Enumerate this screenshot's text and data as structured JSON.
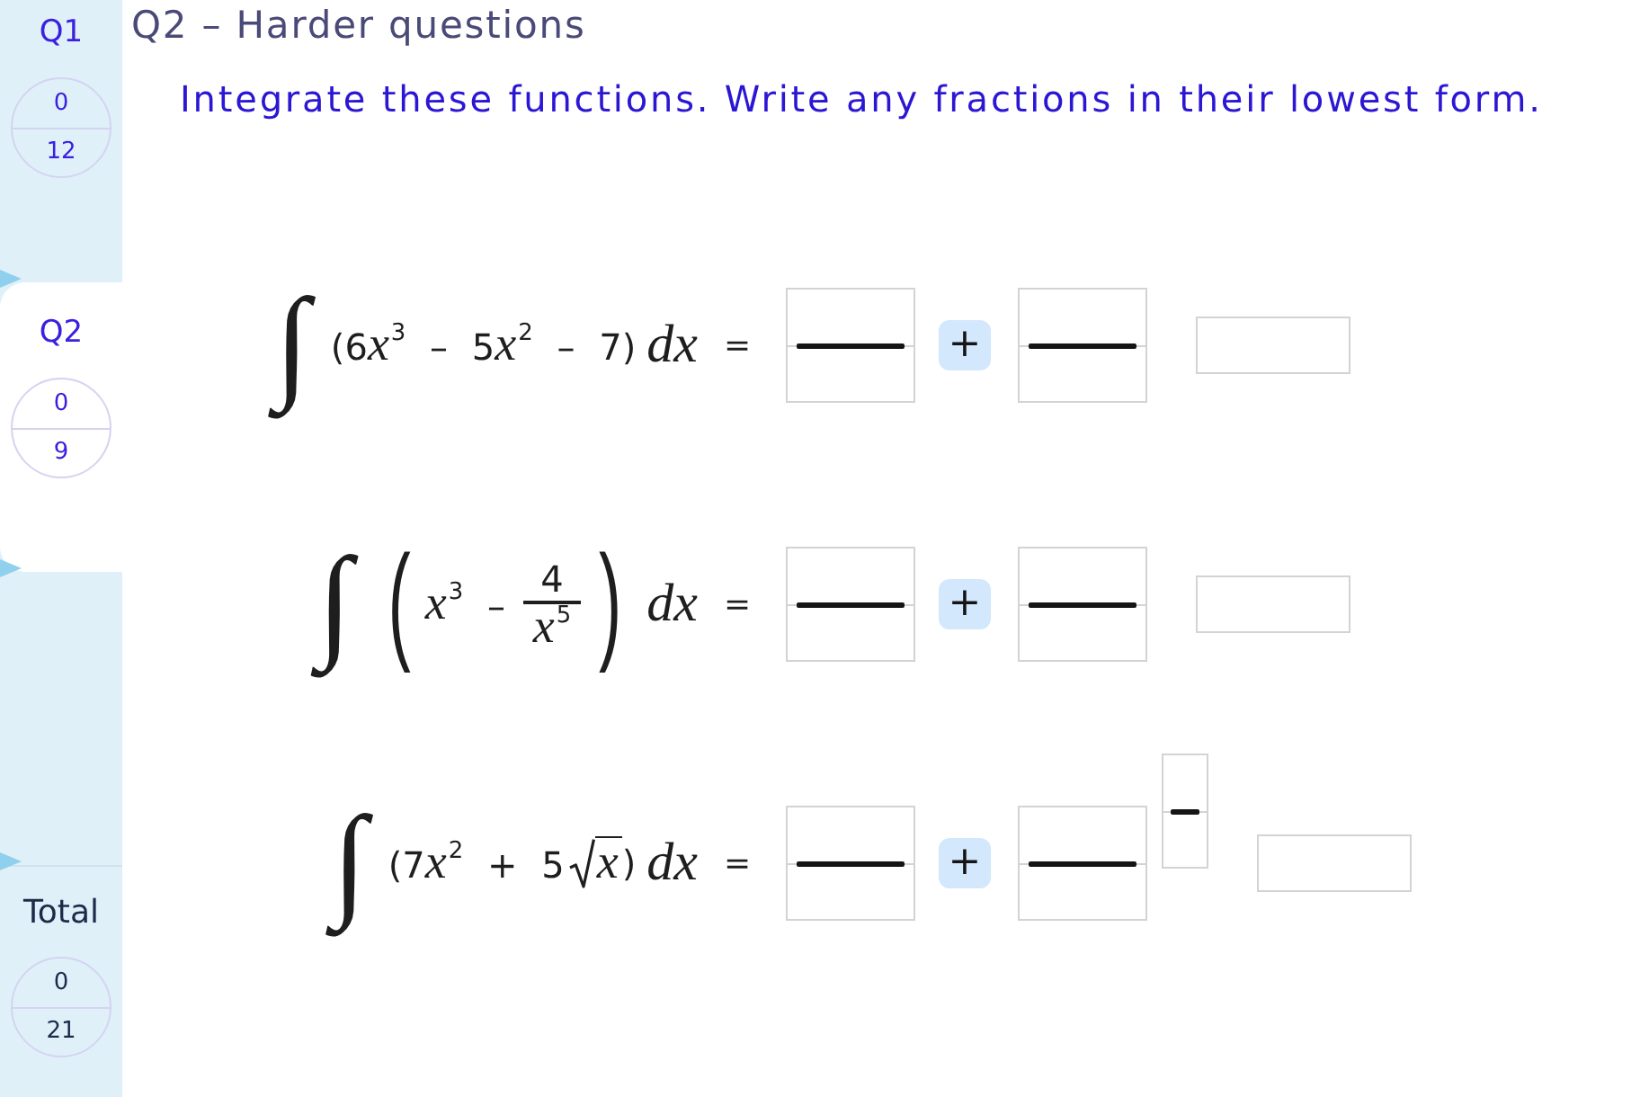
{
  "sidebar": {
    "items": [
      {
        "label": "Q1",
        "score": "0",
        "max": "12",
        "selected": false
      },
      {
        "label": "Q2",
        "score": "0",
        "max": "9",
        "selected": true
      }
    ],
    "total": {
      "label": "Total",
      "score": "0",
      "max": "21"
    }
  },
  "page": {
    "title": "Q2 – Harder questions",
    "instruction": "Integrate these functions. Write any fractions in their lowest form."
  },
  "questions": [
    {
      "integral_sign": "∫",
      "integrand": [
        {
          "kind": "text",
          "tokens": [
            {
              "kind": "plain",
              "text": "(6"
            },
            {
              "kind": "var",
              "text": "x"
            },
            {
              "kind": "sup",
              "text": "3"
            },
            {
              "kind": "plain",
              "text": " – 5"
            },
            {
              "kind": "var",
              "text": "x"
            },
            {
              "kind": "sup",
              "text": "2"
            },
            {
              "kind": "plain",
              "text": " – 7)"
            }
          ]
        }
      ],
      "differential": "dx",
      "equals": "=",
      "answer": [
        {
          "kind": "fraction"
        },
        {
          "kind": "operator",
          "label": "+"
        },
        {
          "kind": "fraction"
        },
        {
          "kind": "box"
        }
      ]
    },
    {
      "integral_sign": "∫",
      "integrand": [
        {
          "kind": "paren",
          "text": "("
        },
        {
          "kind": "text",
          "tokens": [
            {
              "kind": "var",
              "text": "x"
            },
            {
              "kind": "sup",
              "text": "3"
            },
            {
              "kind": "plain",
              "text": " –"
            }
          ]
        },
        {
          "kind": "fraction",
          "numerator": [
            {
              "kind": "plain",
              "text": "4"
            }
          ],
          "denominator": [
            {
              "kind": "var",
              "text": "x"
            },
            {
              "kind": "sup",
              "text": "5"
            }
          ]
        },
        {
          "kind": "paren",
          "text": ")"
        }
      ],
      "differential": "dx",
      "equals": "=",
      "answer": [
        {
          "kind": "fraction"
        },
        {
          "kind": "operator",
          "label": "+"
        },
        {
          "kind": "fraction"
        },
        {
          "kind": "box"
        }
      ]
    },
    {
      "integral_sign": "∫",
      "integrand": [
        {
          "kind": "text",
          "tokens": [
            {
              "kind": "plain",
              "text": "(7"
            },
            {
              "kind": "var",
              "text": "x"
            },
            {
              "kind": "sup",
              "text": "2"
            },
            {
              "kind": "plain",
              "text": " + 5"
            }
          ]
        },
        {
          "kind": "root",
          "radicand": [
            {
              "kind": "var",
              "text": "x"
            }
          ]
        },
        {
          "kind": "text",
          "tokens": [
            {
              "kind": "plain",
              "text": ")"
            }
          ]
        }
      ],
      "differential": "dx",
      "equals": "=",
      "answer": [
        {
          "kind": "fraction"
        },
        {
          "kind": "operator",
          "label": "+"
        },
        {
          "kind": "fraction"
        },
        {
          "kind": "power"
        },
        {
          "kind": "box"
        }
      ]
    }
  ]
}
